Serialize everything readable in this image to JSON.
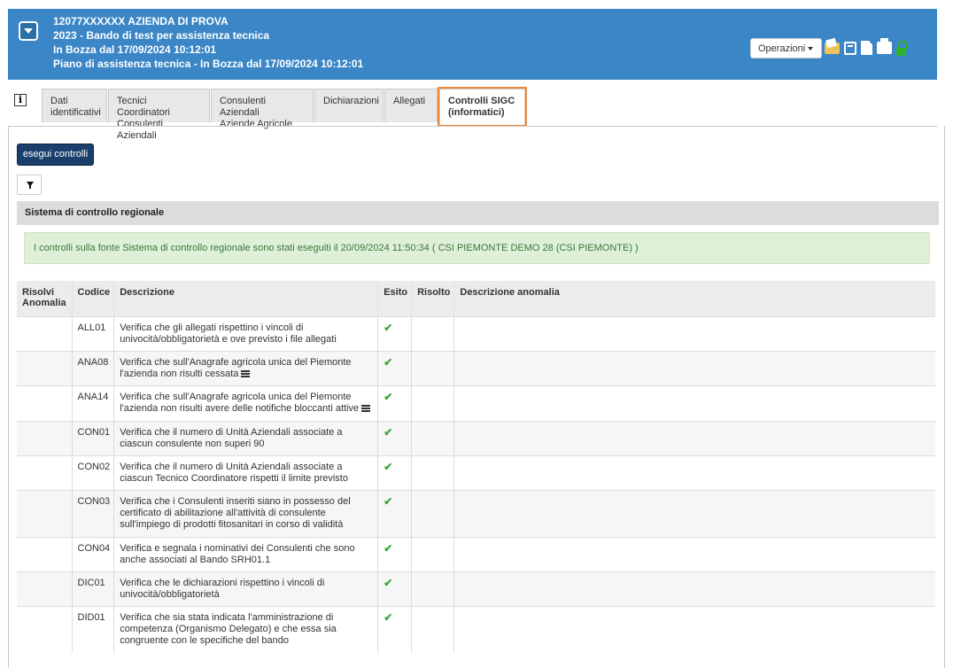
{
  "header": {
    "line1": "12077XXXXXX AZIENDA DI PROVA",
    "line2": "2023 - Bando di test per assistenza tecnica",
    "line3": "In Bozza dal 17/09/2024 10:12:01",
    "line4": "Piano di assistenza tecnica - In Bozza dal 17/09/2024 10:12:01",
    "operations_label": "Operazioni",
    "icons": [
      "folder-icon",
      "list-icon",
      "document-icon",
      "print-icon",
      "unlock-icon"
    ]
  },
  "tabs": [
    {
      "line1": "Dati",
      "line2": "identificativi"
    },
    {
      "line1": "Tecnici Coordinatori",
      "line2": "Consulenti Aziendali"
    },
    {
      "line1": "Consulenti Aziendali",
      "line2": "Aziende Agricole"
    },
    {
      "line1": "Dichiarazioni",
      "line2": ""
    },
    {
      "line1": "Allegati",
      "line2": ""
    },
    {
      "line1": "Controlli SIGC",
      "line2": "(informatici)"
    }
  ],
  "actions": {
    "execute_label": "esegui controlli"
  },
  "section": {
    "title": "Sistema di controllo regionale"
  },
  "alert": {
    "text": "I controlli sulla fonte Sistema di controllo regionale sono stati eseguiti il 20/09/2024 11:50:34 ( CSI PIEMONTE DEMO 28 (CSI PIEMONTE) )"
  },
  "table": {
    "headers": {
      "risolvi_1": "Risolvi",
      "risolvi_2": "Anomalia",
      "codice": "Codice",
      "descrizione": "Descrizione",
      "esito": "Esito",
      "risolto": "Risolto",
      "descrizione_anomalia": "Descrizione anomalia"
    },
    "rows": [
      {
        "code": "ALL01",
        "desc": "Verifica che gli allegati rispettino i vincoli di univocità/obbligatorietà e ove previsto i file allegati",
        "esito": "✔",
        "has_list": false
      },
      {
        "code": "ANA08",
        "desc": "Verifica che sull'Anagrafe agricola unica del Piemonte l'azienda non risulti cessata",
        "esito": "✔",
        "has_list": true
      },
      {
        "code": "ANA14",
        "desc": "Verifica che sull'Anagrafe agricola unica del Piemonte l'azienda non risulti avere delle notifiche bloccanti attive",
        "esito": "✔",
        "has_list": true
      },
      {
        "code": "CON01",
        "desc": "Verifica che il numero di Unità Aziendali associate a ciascun consulente non superi 90",
        "esito": "✔",
        "has_list": false
      },
      {
        "code": "CON02",
        "desc": "Verifica che il numero di Unità Aziendali associate a ciascun Tecnico Coordinatore rispetti il limite previsto",
        "esito": "✔",
        "has_list": false
      },
      {
        "code": "CON03",
        "desc": "Verifica che i Consulenti inseriti siano in possesso del certificato di abilitazione all'attività di consulente sull'impiego di prodotti fitosanitari in corso di validità",
        "esito": "✔",
        "has_list": false
      },
      {
        "code": "CON04",
        "desc": "Verifica e segnala i nominativi dei Consulenti che sono anche associati al Bando SRH01.1",
        "esito": "✔",
        "has_list": false
      },
      {
        "code": "DIC01",
        "desc": "Verifica che le dichiarazioni rispettino i vincoli di univocità/obbligatorietà",
        "esito": "✔",
        "has_list": false
      },
      {
        "code": "DID01",
        "desc": "Verifica che sia stata indicata l'amministrazione di competenza (Organismo Delegato) e che essa sia congruente con le specifiche del bando",
        "esito": "✔",
        "has_list": false
      }
    ]
  }
}
